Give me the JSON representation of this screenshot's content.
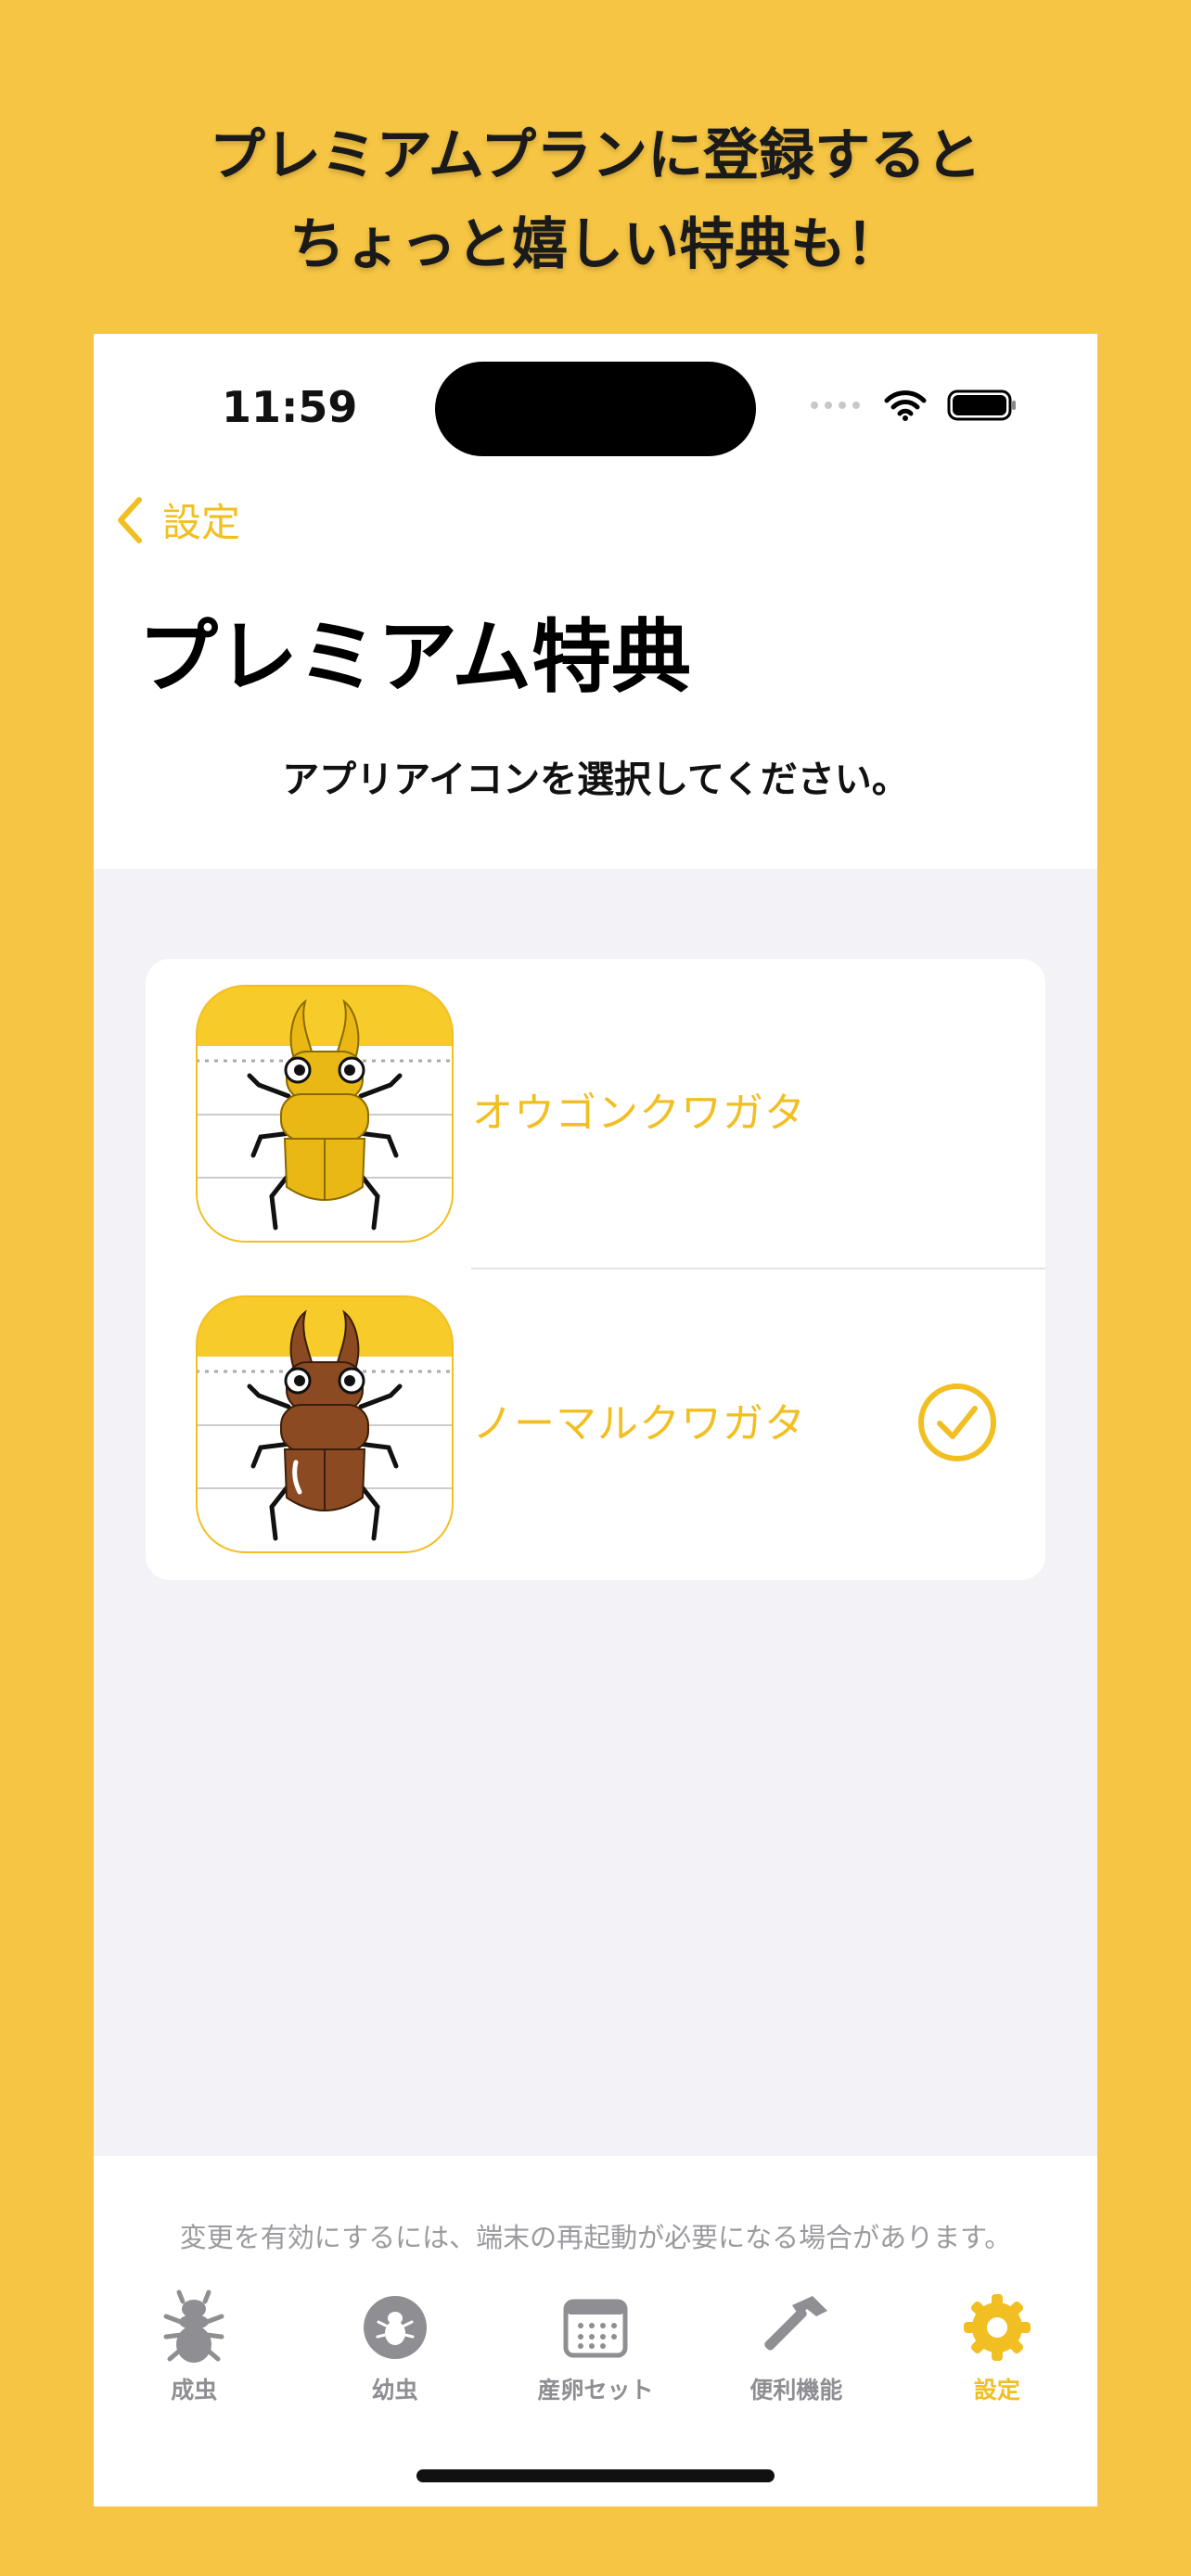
{
  "promo": {
    "line1": "プレミアムプランに登録すると",
    "line2": "ちょっと嬉しい特典も！"
  },
  "status_bar": {
    "time": "11:59"
  },
  "nav": {
    "back_label": "設定",
    "title": "プレミアム特典"
  },
  "instruction": "アプリアイコンを選択してください。",
  "icon_options": [
    {
      "label": "オウゴンクワガタ",
      "selected": false,
      "beetle_color": "#E9B814"
    },
    {
      "label": "ノーマルクワガタ",
      "selected": true,
      "beetle_color": "#8B4A22"
    }
  ],
  "footer_note": "変更を有効にするには、端末の再起動が必要になる場合があります。",
  "tabbar": {
    "items": [
      {
        "label": "成虫",
        "icon": "adult-beetle-icon",
        "active": false
      },
      {
        "label": "幼虫",
        "icon": "larva-icon",
        "active": false
      },
      {
        "label": "産卵セット",
        "icon": "calendar-icon",
        "active": false
      },
      {
        "label": "便利機能",
        "icon": "hammer-icon",
        "active": false
      },
      {
        "label": "設定",
        "icon": "gear-icon",
        "active": true
      }
    ]
  },
  "colors": {
    "accent": "#F2BF22",
    "background": "#F6C544",
    "inactive": "#8E8E93"
  }
}
